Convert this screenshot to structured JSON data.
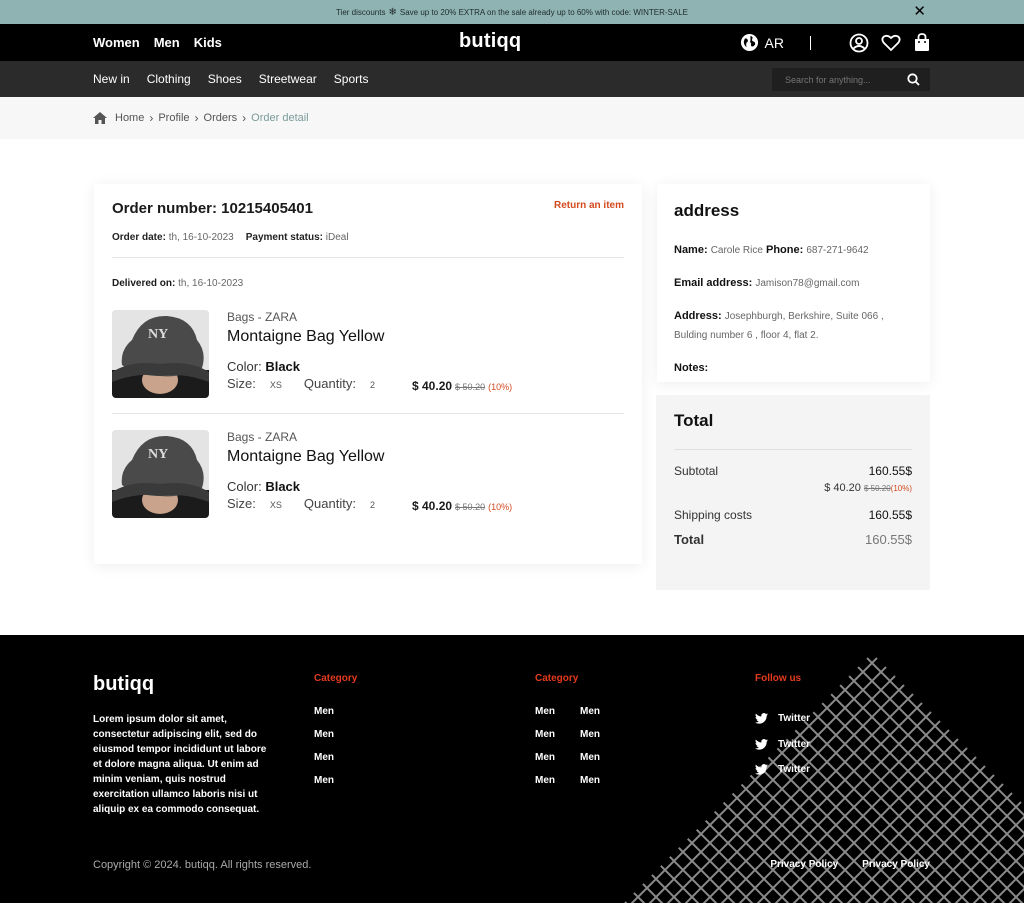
{
  "banner": {
    "text_before": "Tier discounts",
    "snow_icon": "❄",
    "text_after": "Save up to 20% EXTRA on the sale already up to 60% with code: WINTER-SALE",
    "close_icon": "✕"
  },
  "header": {
    "genders": [
      "Women",
      "Men",
      "Kids"
    ],
    "logo": "butiqq",
    "language": "AR"
  },
  "subnav": {
    "links": [
      "New in",
      "Clothing",
      "Shoes",
      "Streetwear",
      "Sports"
    ],
    "search_placeholder": "Search for anything..."
  },
  "breadcrumb": {
    "items": [
      "Home",
      "Profile",
      "Orders"
    ],
    "current": "Order detail"
  },
  "order": {
    "title": "Order number: 10215405401",
    "return_label": "Return an item",
    "order_date_label": "Order date:",
    "order_date": "th, 16-10-2023",
    "payment_label": "Payment status:",
    "payment_status": "iDeal",
    "delivered_label": "Delivered on:",
    "delivered_date": "th, 16-10-2023",
    "items": [
      {
        "category": "Bags - ZARA",
        "name": "Montaigne Bag Yellow",
        "color_label": "Color:",
        "color": "Black",
        "size_label": "Size:",
        "size": "XS",
        "quantity_label": "Quantity:",
        "quantity": "2",
        "price": "$ 40.20",
        "old_price": "$ 50.20",
        "discount": "(10%)"
      },
      {
        "category": "Bags - ZARA",
        "name": "Montaigne Bag Yellow",
        "color_label": "Color:",
        "color": "Black",
        "size_label": "Size:",
        "size": "XS",
        "quantity_label": "Quantity:",
        "quantity": "2",
        "price": "$ 40.20",
        "old_price": "$ 50.20",
        "discount": "(10%)"
      }
    ]
  },
  "address": {
    "title": "address",
    "name_label": "Name:",
    "name": "Carole Rice",
    "phone_label": "Phone:",
    "phone": "687-271-9642",
    "email_label": "Email address:",
    "email": "Jamison78@gmail.com",
    "address_label": "Address:",
    "address": "Josephburgh, Berkshire, Suite 066 , Bulding number 6 , floor 4, flat 2.",
    "notes_label": "Notes:"
  },
  "totals": {
    "title": "Total",
    "subtotal_label": "Subtotal",
    "subtotal": "160.55$",
    "sub_price": "$ 40.20",
    "sub_old_price": "$ 50.20",
    "sub_discount": "(10%)",
    "shipping_label": "Shipping costs",
    "shipping": "160.55$",
    "total_label": "Total",
    "total": "160.55$"
  },
  "footer": {
    "logo": "butiqq",
    "about": "Lorem ipsum dolor sit amet, consectetur adipiscing elit, sed do eiusmod tempor incididunt ut labore et dolore magna aliqua. Ut enim ad minim veniam, quis nostrud exercitation ullamco laboris nisi ut aliquip ex ea commodo consequat.",
    "col1_title": "Category",
    "col1_links": [
      "Men",
      "Men",
      "Men",
      "Men"
    ],
    "col2_title": "Category",
    "col2_links": [
      "Men",
      "Men",
      "Men",
      "Men",
      "Men",
      "Men",
      "Men",
      "Men"
    ],
    "follow_title": "Follow us",
    "social": [
      "Twitter",
      "Twitter",
      "Twitter"
    ],
    "copyright": "Copyright © 2024. butiqq. All rights reserved.",
    "policies": [
      "Privacy Policy",
      "Privacy Policy"
    ]
  },
  "colors": {
    "banner": "#8fb3b3",
    "accent": "#d24a1f",
    "footer_heading": "#e43b1f"
  }
}
